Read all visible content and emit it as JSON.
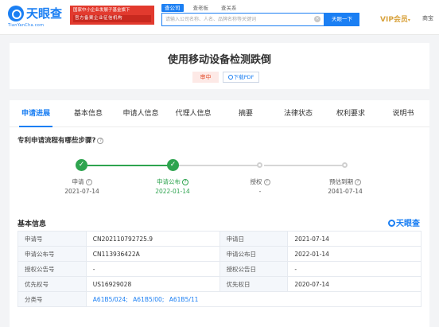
{
  "header": {
    "logo_text": "天眼查",
    "logo_url": "TianYanCha.com",
    "gov_badge_line1": "国家中小企业发展子基金旗下",
    "gov_badge_line2": "官方备案企业征信机构",
    "search_tabs": [
      "查公司",
      "查老板",
      "查关系"
    ],
    "search_placeholder": "请输入公司名称、人名、品牌名称等关键词",
    "search_button": "天眼一下",
    "vip_label": "VIP会员",
    "more_label": "商宝"
  },
  "title_card": {
    "title": "使用移动设备检测跌倒",
    "status": "审中",
    "pdf_button": "下载PDF"
  },
  "tabs": [
    "申请进展",
    "基本信息",
    "申请人信息",
    "代理人信息",
    "摘要",
    "法律状态",
    "权利要求",
    "说明书"
  ],
  "flow": {
    "title": "专利申请流程有哪些步骤?",
    "steps": [
      {
        "label": "申请",
        "date": "2021-07-14",
        "state": "done"
      },
      {
        "label": "申请公布",
        "date": "2022-01-14",
        "state": "current"
      },
      {
        "label": "授权",
        "date": "-",
        "state": "pending"
      },
      {
        "label": "预估到期",
        "date": "2041-07-14",
        "state": "pending"
      }
    ]
  },
  "basic_info": {
    "title": "基本信息",
    "brand": "天眼查",
    "rows": [
      {
        "k1": "申请号",
        "v1": "CN202110792725.9",
        "k2": "申请日",
        "v2": "2021-07-14"
      },
      {
        "k1": "申请公布号",
        "v1": "CN113936422A",
        "k2": "申请公布日",
        "v2": "2022-01-14"
      },
      {
        "k1": "授权公告号",
        "v1": "-",
        "k2": "授权公告日",
        "v2": "-"
      },
      {
        "k1": "优先权号",
        "v1": "US16929028",
        "k2": "优先权日",
        "v2": "2020-07-14"
      }
    ],
    "class_label": "分类号",
    "class_links": [
      "A61B5/024;",
      "A61B5/00;",
      "A61B5/11"
    ]
  },
  "colors": {
    "accent": "#1b7ff3",
    "success": "#2ea44f",
    "status_red": "#e3502f",
    "vip_gold": "#d9a440"
  }
}
